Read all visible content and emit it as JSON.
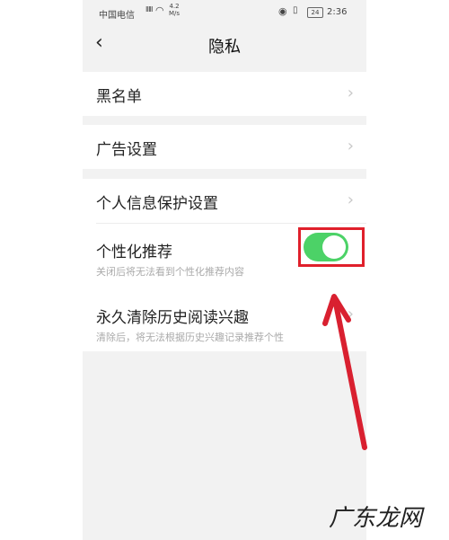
{
  "status_bar": {
    "carrier": "中国电信",
    "signal_mark": "ⅢⅡ",
    "speed": "4.2",
    "speed_unit": "M/s",
    "battery": "24",
    "time": "2:36"
  },
  "header": {
    "back_glyph": "‹",
    "title": "隐私"
  },
  "rows": [
    {
      "label": "黑名单"
    },
    {
      "label": "广告设置"
    },
    {
      "label": "个人信息保护设置"
    },
    {
      "label": "个性化推荐",
      "sub": "关闭后将无法看到个性化推荐内容",
      "toggle_on": true
    },
    {
      "label": "永久清除历史阅读兴趣",
      "sub": "清除后，将无法根据历史兴趣记录推荐个性"
    }
  ],
  "chevron": "›",
  "watermark": "广东龙网",
  "colors": {
    "toggle_on": "#4cd267",
    "highlight": "#e0202b",
    "arrow": "#d92030"
  }
}
